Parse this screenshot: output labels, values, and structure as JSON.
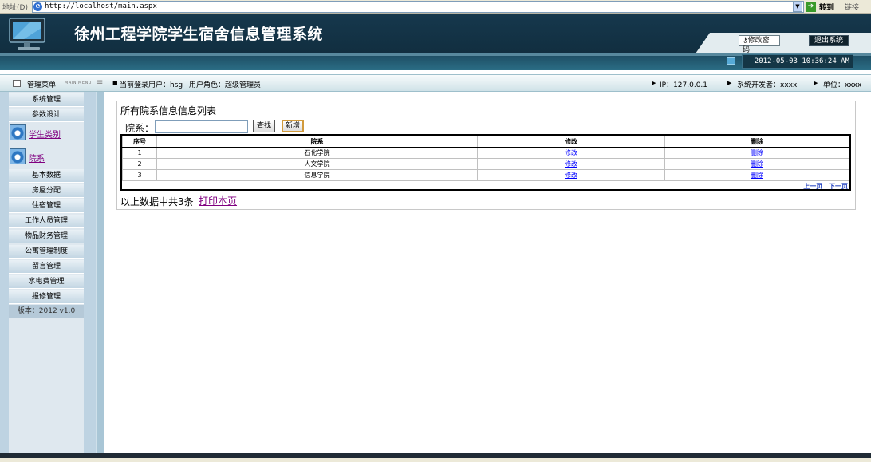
{
  "browser": {
    "address_label": "地址(D)",
    "url": "http://localhost/main.aspx",
    "go_label": "转到",
    "links_label": "链接"
  },
  "header": {
    "title": "徐州工程学院学生宿舍信息管理系统",
    "change_password": "修改密码",
    "logout": "退出系统",
    "datetime": "2012-05-03 10:36:24 AM"
  },
  "infobar": {
    "menu_title": "管理菜单",
    "menu_title_en": "MAIN MENU",
    "current_user": "当前登录用户：hsg",
    "user_role": "用户角色：超级管理员",
    "ip": "IP：127.0.0.1",
    "developer": "系统开发者：xxxx",
    "unit": "单位：xxxx"
  },
  "sidebar": {
    "top_items": [
      "系统管理",
      "参数设计"
    ],
    "categories": [
      "学生类别",
      "院系"
    ],
    "items": [
      "基本数据",
      "房屋分配",
      "住宿管理",
      "工作人员管理",
      "物品财务管理",
      "公寓管理制度",
      "留言管理",
      "水电费管理",
      "报修管理"
    ],
    "version": "版本：2012 v1.0"
  },
  "main": {
    "title": "所有院系信息信息列表",
    "search_label": "院系：",
    "search_value": "",
    "search_button": "查找",
    "add_button": "新增",
    "columns": [
      "序号",
      "院系",
      "修改",
      "删除"
    ],
    "rows": [
      {
        "no": "1",
        "dept": "石化学院",
        "edit": "修改",
        "delete": "删除"
      },
      {
        "no": "2",
        "dept": "人文学院",
        "edit": "修改",
        "delete": "删除"
      },
      {
        "no": "3",
        "dept": "信息学院",
        "edit": "修改",
        "delete": "删除"
      }
    ],
    "prev_page": "上一页",
    "next_page": "下一页",
    "summary": "以上数据中共3条",
    "print_link": "打印本页"
  },
  "colors": {
    "header_bg": "#16384d",
    "sidebar_bg": "#bed3e2",
    "link": "#0000ff",
    "visited_link": "#800080"
  }
}
